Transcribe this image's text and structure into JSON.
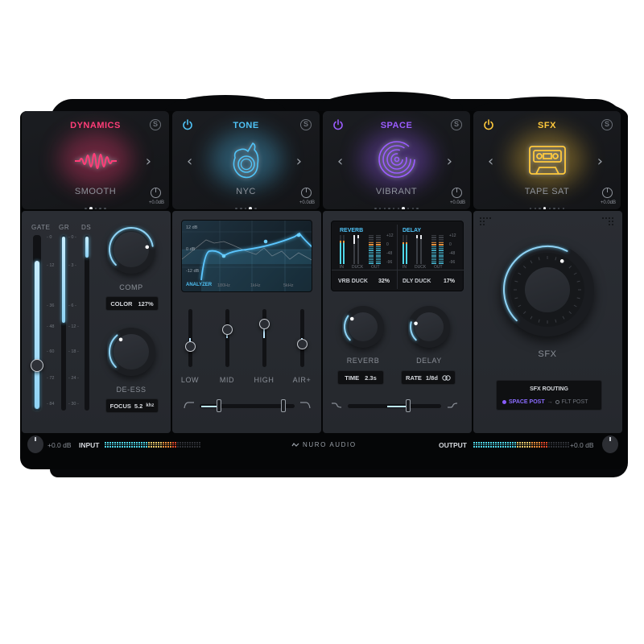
{
  "modules": [
    {
      "id": "dynamics",
      "title": "DYNAMICS",
      "accent": "#ff3d78",
      "preset": "SMOOTH",
      "icon": "waveform-icon",
      "has_power": false,
      "has_prev": false,
      "page_count": 5,
      "active_page": 1,
      "gain": "+0.0dB",
      "solo": "S"
    },
    {
      "id": "tone",
      "title": "TONE",
      "accent": "#4fc3f7",
      "preset": "NYC",
      "icon": "tone-dial-icon",
      "has_power": true,
      "has_prev": true,
      "page_count": 5,
      "active_page": 3,
      "gain": "+0.0dB",
      "solo": "S"
    },
    {
      "id": "space",
      "title": "SPACE",
      "accent": "#9b5cff",
      "preset": "VIBRANT",
      "icon": "spiral-icon",
      "has_power": true,
      "has_prev": true,
      "page_count": 10,
      "active_page": 6,
      "gain": "+0.0dB",
      "solo": "S"
    },
    {
      "id": "sfx",
      "title": "SFX",
      "accent": "#ffc93c",
      "preset": "TAPE SAT",
      "icon": "cassette-icon",
      "has_power": true,
      "has_prev": true,
      "page_count": 8,
      "active_page": 3,
      "gain": "+0.0dB",
      "solo": "S"
    }
  ],
  "dynamics_panel": {
    "meters": [
      {
        "label": "GATE",
        "level": 0.86,
        "ticks": [
          "0",
          "12",
          "36",
          "48",
          "60",
          "72",
          "84"
        ],
        "thumb": 0.71
      },
      {
        "label": "GR",
        "level": 0.5,
        "ticks": [
          "0",
          "3",
          "6",
          "12",
          "18",
          "24",
          "30"
        ]
      },
      {
        "label": "DS",
        "level": 0.12
      }
    ],
    "comp": {
      "label": "COMP",
      "value": 0.8,
      "box_label": "COLOR",
      "box_value": "127%"
    },
    "deess": {
      "label": "DE-ESS",
      "value": 0.35,
      "box_label": "FOCUS",
      "box_value": "5.2",
      "box_unit": "khz"
    }
  },
  "tone_panel": {
    "analyzer": {
      "label": "ANALYZER",
      "db_labels": [
        "12 dB",
        "0 dB",
        "-12 dB"
      ],
      "freq_labels": [
        "180Hz",
        "1kHz",
        "5kHz"
      ]
    },
    "bands": [
      {
        "label": "LOW",
        "value": 0.35
      },
      {
        "label": "MID",
        "value": 0.65
      },
      {
        "label": "HIGH",
        "value": 0.75
      },
      {
        "label": "AIR+",
        "value": 0.4
      }
    ],
    "filter_range": {
      "low": 0.2,
      "high": 0.88
    }
  },
  "space_panel": {
    "reverb_meter": {
      "title": "REVERB",
      "labels": [
        "IN",
        "DUCK",
        "OUT"
      ]
    },
    "delay_meter": {
      "title": "DELAY",
      "labels": [
        "IN",
        "DUCK",
        "OUT"
      ]
    },
    "scale": [
      "+12",
      "0",
      "-48",
      "-96"
    ],
    "vrb_duck": {
      "label": "VRB DUCK",
      "value": "32%"
    },
    "dly_duck": {
      "label": "DLY DUCK",
      "value": "17%"
    },
    "reverb": {
      "label": "REVERB",
      "value": 0.3,
      "box_label": "TIME",
      "box_value": "2.3s"
    },
    "delay": {
      "label": "DELAY",
      "value": 0.22,
      "box_label": "RATE",
      "box_value": "1/8d"
    },
    "tilt": 0.65
  },
  "sfx_panel": {
    "knob_label": "SFX",
    "value": 0.6,
    "routing_title": "SFX ROUTING",
    "routing_active": "SPACE POST",
    "routing_inactive": "FLT POST",
    "routing_arrow": "→"
  },
  "footer": {
    "input_gain": "+0.0 dB",
    "input_label": "INPUT",
    "input_level": 0.75,
    "brand": "NURO AUDIO",
    "output_label": "OUTPUT",
    "output_level": 0.78,
    "output_gain": "+0.0 dB"
  }
}
